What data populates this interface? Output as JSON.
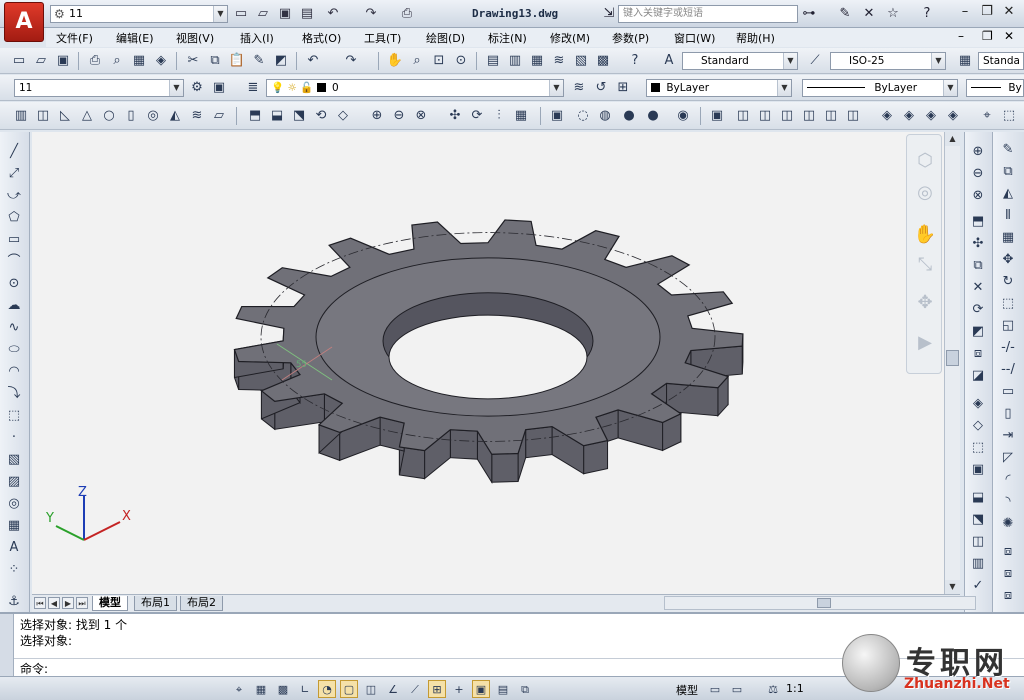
{
  "titlebar": {
    "app_logo_letter": "A",
    "workspace": "11",
    "document_title": "Drawing13.dwg",
    "search_placeholder": "键入关键字或短语"
  },
  "menu": [
    "文件(F)",
    "编辑(E)",
    "视图(V)",
    "插入(I)",
    "格式(O)",
    "工具(T)",
    "绘图(D)",
    "标注(N)",
    "修改(M)",
    "参数(P)",
    "窗口(W)",
    "帮助(H)"
  ],
  "styles_toolbar": {
    "text_style": "Standard",
    "dim_style": "ISO-25",
    "table_style": "Standa"
  },
  "layers_toolbar": {
    "layer_state": "11",
    "current_layer": "0",
    "color": "ByLayer",
    "linetype": "ByLayer",
    "lineweight": "By"
  },
  "layout_tabs": [
    "模型",
    "布局1",
    "布局2"
  ],
  "command": {
    "history": [
      "选择对象: 找到 1 个",
      "选择对象:"
    ],
    "prompt": "命令:"
  },
  "status": {
    "model_label": "模型",
    "annotation_scale": "1:1"
  },
  "ucs": {
    "x_label": "X",
    "y_label": "Y",
    "z_label": "Z"
  },
  "watermark": {
    "cn": "专职网",
    "en": "Zhuanzhi.Net"
  },
  "colors": {
    "gear_face": "#707078",
    "canvas": "#f2f2f2",
    "logo_red": "#d22b1c"
  }
}
